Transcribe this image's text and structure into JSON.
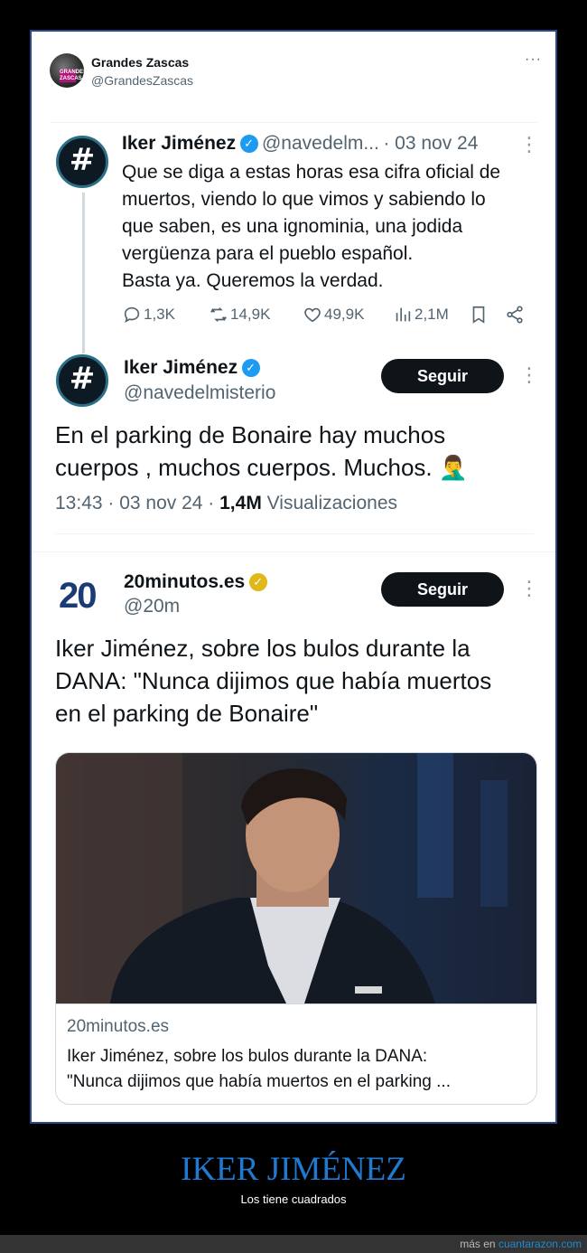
{
  "header": {
    "name": "Grandes Zascas",
    "handle": "@GrandesZascas",
    "avatar_text": "GRANDES ZASCAS",
    "more": "···"
  },
  "quoted_tweet": {
    "name": "Iker Jiménez",
    "handle": "@navedelm...",
    "date": "· 03 nov 24",
    "avatar_glyph": "#",
    "lines": [
      "Que se diga a estas horas esa cifra oficial de",
      "muertos, viendo lo que vimos y sabiendo lo",
      "que saben, es una ignominia, una jodida",
      "vergüenza para el pueblo español.",
      "Basta ya. Queremos la verdad."
    ],
    "stats": {
      "replies": "1,3K",
      "retweets": "14,9K",
      "likes": "49,9K",
      "views": "2,1M"
    }
  },
  "reply_tweet": {
    "name": "Iker Jiménez",
    "handle": "@navedelmisterio",
    "follow_label": "Seguir",
    "avatar_glyph": "#",
    "lines": [
      "En el parking de Bonaire hay muchos",
      "cuerpos , muchos cuerpos. Muchos. 🤦‍♂️"
    ],
    "time": "13:43 · 03 nov 24 · ",
    "views_count": "1,4M",
    "views_label": " Visualizaciones"
  },
  "news_tweet": {
    "name": "20minutos.es",
    "handle": "@20m",
    "logo": "20",
    "follow_label": "Seguir",
    "lines": [
      "Iker Jiménez, sobre los bulos durante la",
      "DANA: \"Nunca dijimos que había muertos",
      "en el parking de Bonaire\""
    ],
    "card": {
      "domain": "20minutos.es",
      "title_lines": [
        "Iker Jiménez, sobre los bulos durante la DANA:",
        "\"Nunca dijimos que había muertos en el parking ..."
      ]
    }
  },
  "caption": {
    "title": "IKER JIMÉNEZ",
    "subtitle": "Los tiene cuadrados"
  },
  "footer": {
    "prefix": "más en ",
    "link": "cuantarazon.com"
  },
  "colors": {
    "verified_blue": "#1d9bf0",
    "verified_gold": "#e2b719",
    "caption_blue": "#1f7ad1",
    "follow_button": "#0f1419"
  }
}
